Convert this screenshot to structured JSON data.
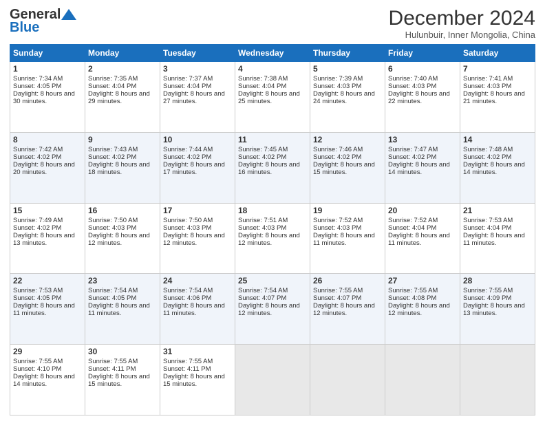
{
  "logo": {
    "general": "General",
    "blue": "Blue"
  },
  "header": {
    "month": "December 2024",
    "location": "Hulunbuir, Inner Mongolia, China"
  },
  "days": [
    "Sunday",
    "Monday",
    "Tuesday",
    "Wednesday",
    "Thursday",
    "Friday",
    "Saturday"
  ],
  "weeks": [
    [
      {
        "day": "1",
        "sunrise": "7:34 AM",
        "sunset": "4:05 PM",
        "daylight": "8 hours and 30 minutes."
      },
      {
        "day": "2",
        "sunrise": "7:35 AM",
        "sunset": "4:04 PM",
        "daylight": "8 hours and 29 minutes."
      },
      {
        "day": "3",
        "sunrise": "7:37 AM",
        "sunset": "4:04 PM",
        "daylight": "8 hours and 27 minutes."
      },
      {
        "day": "4",
        "sunrise": "7:38 AM",
        "sunset": "4:04 PM",
        "daylight": "8 hours and 25 minutes."
      },
      {
        "day": "5",
        "sunrise": "7:39 AM",
        "sunset": "4:03 PM",
        "daylight": "8 hours and 24 minutes."
      },
      {
        "day": "6",
        "sunrise": "7:40 AM",
        "sunset": "4:03 PM",
        "daylight": "8 hours and 22 minutes."
      },
      {
        "day": "7",
        "sunrise": "7:41 AM",
        "sunset": "4:03 PM",
        "daylight": "8 hours and 21 minutes."
      }
    ],
    [
      {
        "day": "8",
        "sunrise": "7:42 AM",
        "sunset": "4:02 PM",
        "daylight": "8 hours and 20 minutes."
      },
      {
        "day": "9",
        "sunrise": "7:43 AM",
        "sunset": "4:02 PM",
        "daylight": "8 hours and 18 minutes."
      },
      {
        "day": "10",
        "sunrise": "7:44 AM",
        "sunset": "4:02 PM",
        "daylight": "8 hours and 17 minutes."
      },
      {
        "day": "11",
        "sunrise": "7:45 AM",
        "sunset": "4:02 PM",
        "daylight": "8 hours and 16 minutes."
      },
      {
        "day": "12",
        "sunrise": "7:46 AM",
        "sunset": "4:02 PM",
        "daylight": "8 hours and 15 minutes."
      },
      {
        "day": "13",
        "sunrise": "7:47 AM",
        "sunset": "4:02 PM",
        "daylight": "8 hours and 14 minutes."
      },
      {
        "day": "14",
        "sunrise": "7:48 AM",
        "sunset": "4:02 PM",
        "daylight": "8 hours and 14 minutes."
      }
    ],
    [
      {
        "day": "15",
        "sunrise": "7:49 AM",
        "sunset": "4:02 PM",
        "daylight": "8 hours and 13 minutes."
      },
      {
        "day": "16",
        "sunrise": "7:50 AM",
        "sunset": "4:03 PM",
        "daylight": "8 hours and 12 minutes."
      },
      {
        "day": "17",
        "sunrise": "7:50 AM",
        "sunset": "4:03 PM",
        "daylight": "8 hours and 12 minutes."
      },
      {
        "day": "18",
        "sunrise": "7:51 AM",
        "sunset": "4:03 PM",
        "daylight": "8 hours and 12 minutes."
      },
      {
        "day": "19",
        "sunrise": "7:52 AM",
        "sunset": "4:03 PM",
        "daylight": "8 hours and 11 minutes."
      },
      {
        "day": "20",
        "sunrise": "7:52 AM",
        "sunset": "4:04 PM",
        "daylight": "8 hours and 11 minutes."
      },
      {
        "day": "21",
        "sunrise": "7:53 AM",
        "sunset": "4:04 PM",
        "daylight": "8 hours and 11 minutes."
      }
    ],
    [
      {
        "day": "22",
        "sunrise": "7:53 AM",
        "sunset": "4:05 PM",
        "daylight": "8 hours and 11 minutes."
      },
      {
        "day": "23",
        "sunrise": "7:54 AM",
        "sunset": "4:05 PM",
        "daylight": "8 hours and 11 minutes."
      },
      {
        "day": "24",
        "sunrise": "7:54 AM",
        "sunset": "4:06 PM",
        "daylight": "8 hours and 11 minutes."
      },
      {
        "day": "25",
        "sunrise": "7:54 AM",
        "sunset": "4:07 PM",
        "daylight": "8 hours and 12 minutes."
      },
      {
        "day": "26",
        "sunrise": "7:55 AM",
        "sunset": "4:07 PM",
        "daylight": "8 hours and 12 minutes."
      },
      {
        "day": "27",
        "sunrise": "7:55 AM",
        "sunset": "4:08 PM",
        "daylight": "8 hours and 12 minutes."
      },
      {
        "day": "28",
        "sunrise": "7:55 AM",
        "sunset": "4:09 PM",
        "daylight": "8 hours and 13 minutes."
      }
    ],
    [
      {
        "day": "29",
        "sunrise": "7:55 AM",
        "sunset": "4:10 PM",
        "daylight": "8 hours and 14 minutes."
      },
      {
        "day": "30",
        "sunrise": "7:55 AM",
        "sunset": "4:11 PM",
        "daylight": "8 hours and 15 minutes."
      },
      {
        "day": "31",
        "sunrise": "7:55 AM",
        "sunset": "4:11 PM",
        "daylight": "8 hours and 15 minutes."
      },
      null,
      null,
      null,
      null
    ]
  ]
}
